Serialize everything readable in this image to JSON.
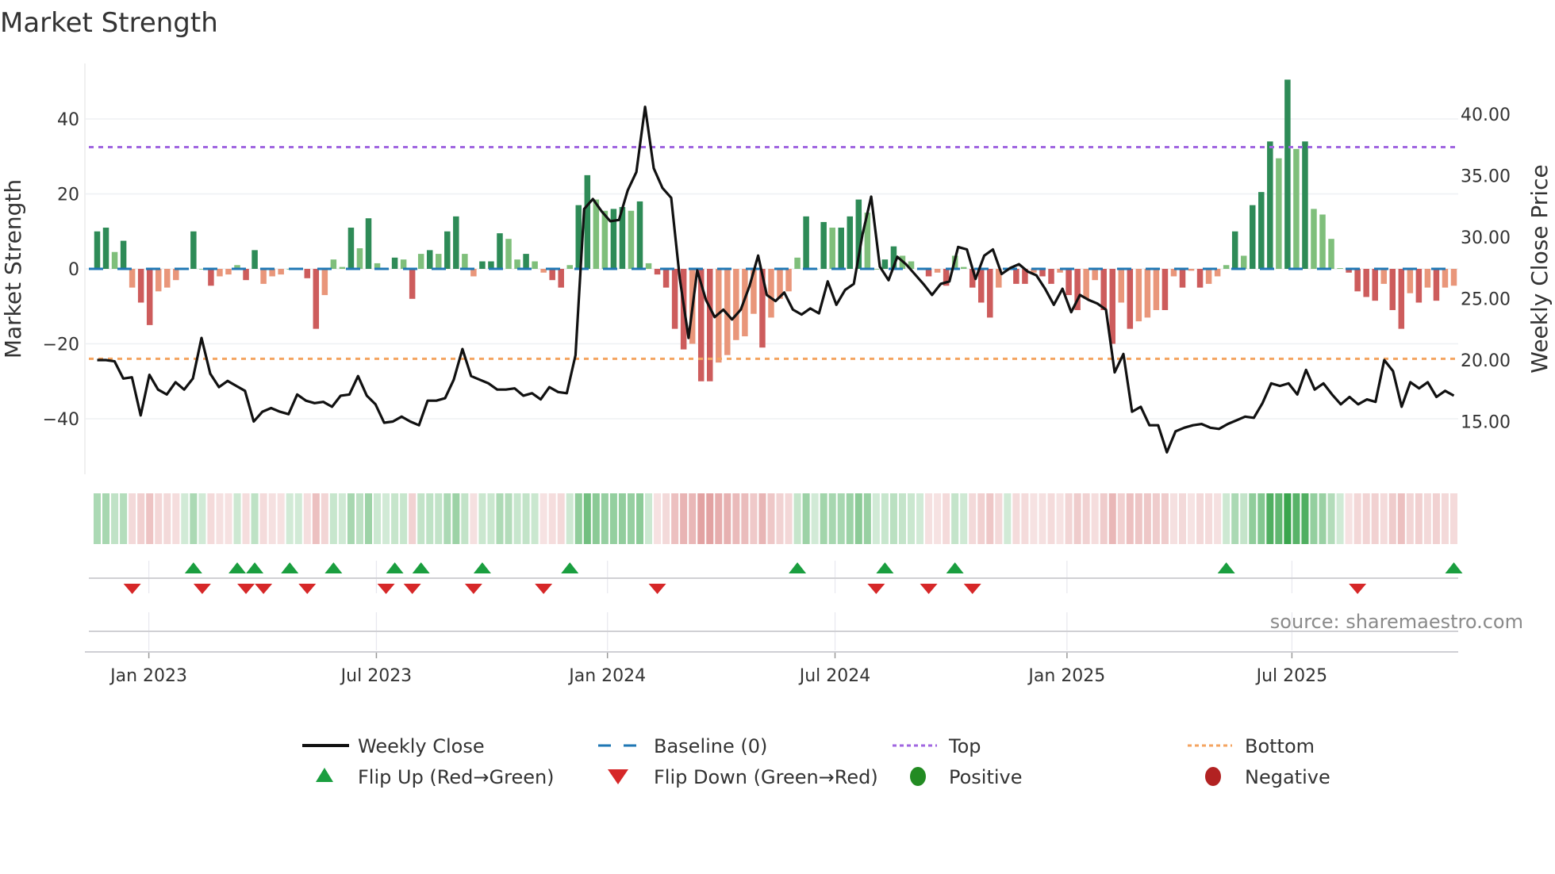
{
  "chart_data": {
    "type": "bar",
    "title": "Market Strength",
    "ylabel": "Market Strength",
    "y2label": "Weekly Close Price",
    "ylim": [
      -55,
      55
    ],
    "y2lim": [
      11,
      44
    ],
    "yticks": [
      40,
      20,
      0,
      -20,
      -40
    ],
    "yticks_labels": [
      "40",
      "20",
      "0",
      "−20",
      "−40"
    ],
    "y2ticks": [
      40,
      35,
      30,
      25,
      20,
      15
    ],
    "y2ticks_labels": [
      "40.00",
      "35.00",
      "30.00",
      "25.00",
      "20.00",
      "15.00"
    ],
    "xticks": [
      {
        "label": "Jan 2023",
        "week": 5.9
      },
      {
        "label": "Jul 2023",
        "week": 31.9
      },
      {
        "label": "Jan 2024",
        "week": 58.3
      },
      {
        "label": "Jul 2024",
        "week": 84.3
      },
      {
        "label": "Jan 2025",
        "week": 110.8
      },
      {
        "label": "Jul 2025",
        "week": 136.5
      }
    ],
    "top_level": 32.5,
    "bottom_level": -24,
    "baseline": 0,
    "strength": [
      10,
      11,
      4.5,
      7.5,
      -5,
      -9,
      -15,
      -6,
      -5,
      -3,
      0,
      10,
      0,
      -4.5,
      -2,
      -1.5,
      1,
      -3,
      5,
      -4,
      -2,
      -1.5,
      0,
      0,
      -2.5,
      -16,
      -7,
      2.5,
      0.5,
      11,
      5.5,
      13.5,
      1.5,
      0,
      3,
      2.5,
      -8,
      4,
      5,
      4,
      10,
      14,
      4,
      -2,
      2,
      2,
      9.5,
      8,
      2.5,
      4,
      2,
      -1,
      -3,
      -5,
      1,
      17,
      25,
      18.5,
      15.5,
      16,
      16.5,
      15.5,
      18,
      1.5,
      -1.5,
      -5,
      -16,
      -21.5,
      -20,
      -30,
      -30,
      -25,
      -23,
      -19,
      -18,
      -12,
      -21,
      -13,
      -8,
      -6,
      3,
      14,
      0,
      12.5,
      11,
      11,
      14,
      18.5,
      15,
      0,
      2.5,
      6,
      3.5,
      2,
      0,
      -2,
      -1,
      -4.5,
      3.5,
      0.5,
      -5,
      -9,
      -13,
      -5,
      0,
      -4,
      -4,
      -1,
      -2,
      -4,
      -1,
      -7,
      -11,
      -8,
      -3,
      -11,
      -20,
      -9,
      -16,
      -14,
      -13,
      -11,
      -11,
      -2,
      -5,
      -0.5,
      -5,
      -4,
      -2,
      1,
      10,
      3.5,
      17,
      20.5,
      34,
      29.5,
      50.5,
      32,
      34,
      16,
      14.5,
      8,
      0.2,
      -1,
      -6,
      -7.5,
      -8.5,
      -4,
      -11,
      -16,
      -6.5,
      -9,
      -5,
      -8.5,
      -5,
      -4.5
    ],
    "weekly_close": [
      20.0,
      20.0,
      19.9,
      18.5,
      18.6,
      15.5,
      18.8,
      17.6,
      17.2,
      18.2,
      17.6,
      18.5,
      21.8,
      18.9,
      17.8,
      18.3,
      17.9,
      17.5,
      15.0,
      15.8,
      16.1,
      15.8,
      15.6,
      17.2,
      16.7,
      16.5,
      16.6,
      16.2,
      17.1,
      17.2,
      18.7,
      17.1,
      16.4,
      14.9,
      15.0,
      15.4,
      15.0,
      14.7,
      16.7,
      16.7,
      16.9,
      18.4,
      20.9,
      18.7,
      18.4,
      18.1,
      17.6,
      17.6,
      17.7,
      17.1,
      17.3,
      16.8,
      17.8,
      17.4,
      17.3,
      20.4,
      32.3,
      33.1,
      32.1,
      31.3,
      31.4,
      33.8,
      35.3,
      40.6,
      35.6,
      34.0,
      33.2,
      26.6,
      21.8,
      27.3,
      24.9,
      23.5,
      24.1,
      23.3,
      24.1,
      26.0,
      28.5,
      25.3,
      24.8,
      25.5,
      24.1,
      23.7,
      24.2,
      23.8,
      26.4,
      24.5,
      25.7,
      26.2,
      30.2,
      33.3,
      27.6,
      26.5,
      28.4,
      27.8,
      27.0,
      26.2,
      25.3,
      26.2,
      26.4,
      29.2,
      29.0,
      26.6,
      28.5,
      29.0,
      27.0,
      27.5,
      27.8,
      27.2,
      26.9,
      25.8,
      24.5,
      25.8,
      23.9,
      25.3,
      24.9,
      24.6,
      24.1,
      19.0,
      20.5,
      15.8,
      16.2,
      14.7,
      14.7,
      12.5,
      14.2,
      14.5,
      14.7,
      14.8,
      14.5,
      14.4,
      14.8,
      15.1,
      15.4,
      15.3,
      16.5,
      18.1,
      17.9,
      18.1,
      17.2,
      19.2,
      17.6,
      18.1,
      17.2,
      16.4,
      17.0,
      16.4,
      16.8,
      16.6,
      20.0,
      19.1,
      16.2,
      18.2,
      17.7,
      18.2,
      17.0,
      17.5,
      17.1
    ],
    "flip_up_weeks": [
      11,
      16,
      18,
      22,
      27,
      34,
      37,
      44,
      54,
      80,
      90,
      98,
      129,
      155
    ],
    "flip_down_weeks": [
      4,
      12,
      17,
      19,
      24,
      33,
      36,
      43,
      51,
      64,
      89,
      95,
      100,
      144
    ],
    "legend": {
      "placement": "bottom",
      "items": [
        {
          "label": "Weekly Close",
          "kind": "line"
        },
        {
          "label": "Baseline (0)",
          "kind": "dash"
        },
        {
          "label": "Top",
          "kind": "dot-purple"
        },
        {
          "label": "Bottom",
          "kind": "dot-orange"
        },
        {
          "label": "Flip Up (Red→Green)",
          "kind": "tri-up"
        },
        {
          "label": "Flip Down (Green→Red)",
          "kind": "tri-down"
        },
        {
          "label": "Positive",
          "kind": "dot-green"
        },
        {
          "label": "Negative",
          "kind": "dot-red"
        }
      ]
    },
    "source": "source: sharemaestro.com",
    "colors": {
      "pos_strong": "#2e8b57",
      "pos_weak": "#7fbf7b",
      "neg_strong": "#cd5c5c",
      "neg_weak": "#e9967a",
      "baseline": "#1f77b4",
      "top": "#a066e0",
      "bottom": "#f4a460",
      "flip_up": "#1a9e3f",
      "flip_down": "#d62728",
      "positive": "#228b22",
      "negative": "#b22222",
      "line": "#111111"
    }
  }
}
